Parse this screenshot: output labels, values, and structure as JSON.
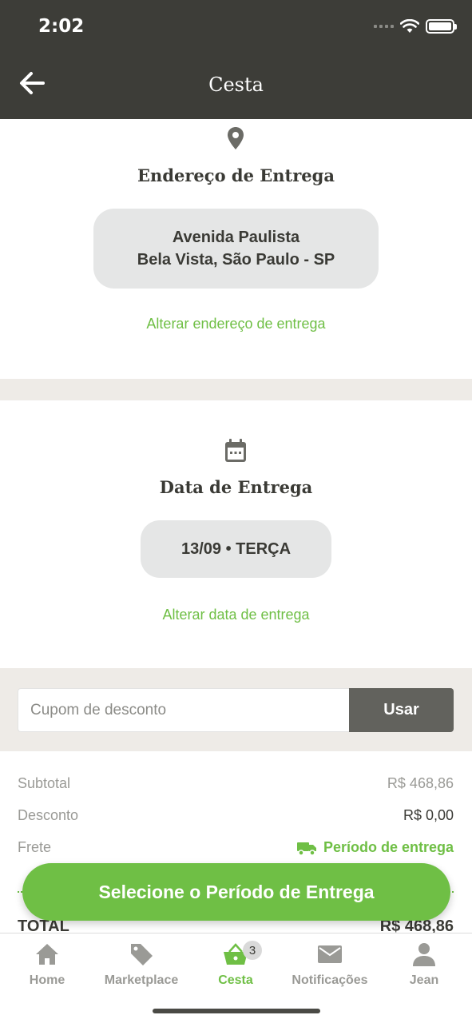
{
  "status": {
    "time": "2:02"
  },
  "header": {
    "title": "Cesta"
  },
  "address": {
    "heading": "Endereço de Entrega",
    "line1": "Avenida Paulista",
    "line2": "Bela Vista, São Paulo - SP",
    "change_link": "Alterar endereço de entrega"
  },
  "delivery_date": {
    "heading": "Data de Entrega",
    "value": "13/09 • TERÇA",
    "change_link": "Alterar data de entrega"
  },
  "coupon": {
    "placeholder": "Cupom de desconto",
    "button": "Usar"
  },
  "summary": {
    "subtotal_label": "Subtotal",
    "subtotal_value": "R$ 468,86",
    "discount_label": "Desconto",
    "discount_value": "R$ 0,00",
    "shipping_label": "Frete",
    "shipping_value": "Período de entrega",
    "total_label": "TOTAL",
    "total_value": "R$ 468,86"
  },
  "cta": {
    "label": "Selecione o Período de Entrega"
  },
  "tabbar": {
    "items": [
      {
        "label": "Home",
        "icon": "home-icon"
      },
      {
        "label": "Marketplace",
        "icon": "tag-icon"
      },
      {
        "label": "Cesta",
        "icon": "basket-icon",
        "badge": "3",
        "active": true
      },
      {
        "label": "Notificações",
        "icon": "envelope-icon"
      },
      {
        "label": "Jean",
        "icon": "user-icon"
      }
    ]
  },
  "colors": {
    "header": "#3d3d38",
    "accent": "#6fbf45",
    "pill": "#e5e6e6",
    "band": "#eeebe7"
  }
}
